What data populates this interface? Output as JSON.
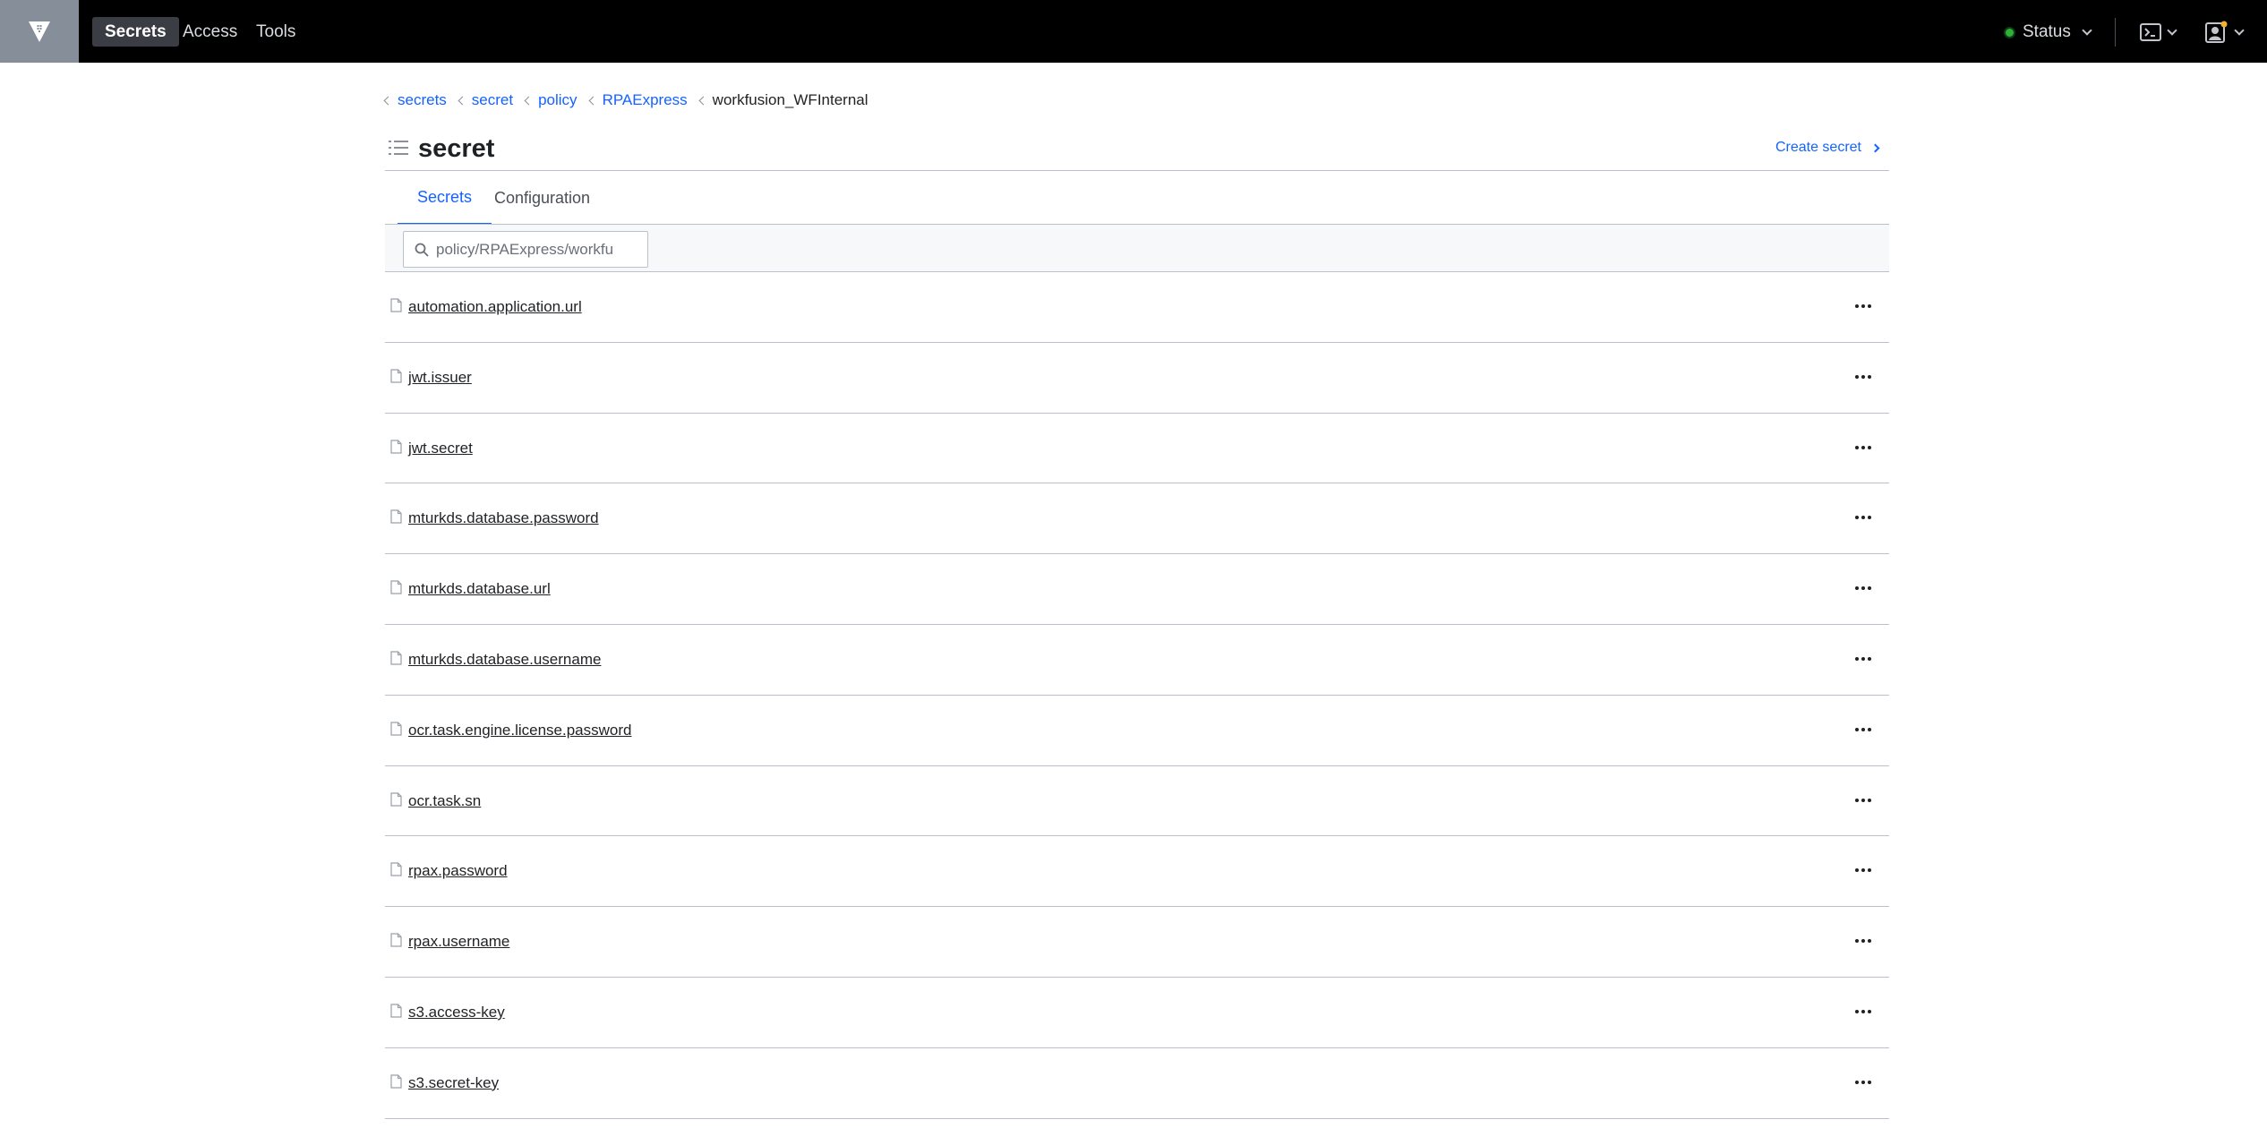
{
  "nav": {
    "items": [
      {
        "label": "Secrets",
        "active": true
      },
      {
        "label": "Access",
        "active": false
      },
      {
        "label": "Tools",
        "active": false
      }
    ],
    "status_label": "Status",
    "status_color": "#2eb039"
  },
  "breadcrumb": {
    "items": [
      "secrets",
      "secret",
      "policy",
      "RPAExpress"
    ],
    "current": "workfusion_WFInternal"
  },
  "page": {
    "title": "secret",
    "create_label": "Create secret"
  },
  "tabs": [
    {
      "label": "Secrets",
      "active": true
    },
    {
      "label": "Configuration",
      "active": false
    }
  ],
  "filter": {
    "value": "policy/RPAExpress/workfu"
  },
  "secrets": [
    {
      "name": "automation.application.url"
    },
    {
      "name": "jwt.issuer"
    },
    {
      "name": "jwt.secret"
    },
    {
      "name": "mturkds.database.password"
    },
    {
      "name": "mturkds.database.url"
    },
    {
      "name": "mturkds.database.username"
    },
    {
      "name": "ocr.task.engine.license.password"
    },
    {
      "name": "ocr.task.sn"
    },
    {
      "name": "rpax.password"
    },
    {
      "name": "rpax.username"
    },
    {
      "name": "s3.access-key"
    },
    {
      "name": "s3.secret-key"
    }
  ],
  "icons": {
    "logo": "vault-logo-icon",
    "row": "file-icon",
    "row_menu": "more-horizontal-icon",
    "console": "terminal-icon",
    "user": "user-icon",
    "title": "list-icon",
    "search": "search-icon"
  },
  "colors": {
    "accent": "#1563ff",
    "navbar": "#000000",
    "status_ok": "#2eb039",
    "notification_dot": "#f2b132"
  }
}
